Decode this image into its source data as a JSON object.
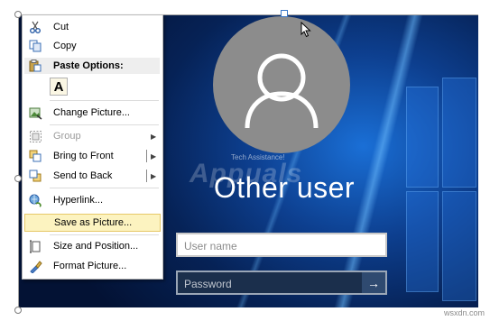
{
  "context_menu": {
    "items": [
      {
        "label": "Cut",
        "icon": "scissors-icon",
        "state": "enabled"
      },
      {
        "label": "Copy",
        "icon": "copy-icon",
        "state": "enabled"
      },
      {
        "label": "Paste Options:",
        "icon": "paste-icon",
        "state": "header"
      },
      {
        "label": "A",
        "icon": "paste-keep-text-icon",
        "state": "enabled"
      },
      {
        "label": "Change Picture...",
        "icon": "change-picture-icon",
        "state": "enabled"
      },
      {
        "label": "Group",
        "icon": "group-icon",
        "state": "disabled",
        "submenu": true
      },
      {
        "label": "Bring to Front",
        "icon": "bring-to-front-icon",
        "state": "enabled",
        "submenu": true
      },
      {
        "label": "Send to Back",
        "icon": "send-to-back-icon",
        "state": "enabled",
        "submenu": true
      },
      {
        "label": "Hyperlink...",
        "icon": "hyperlink-icon",
        "state": "enabled"
      },
      {
        "label": "Save as Picture...",
        "icon": "",
        "state": "highlighted"
      },
      {
        "label": "Size and Position...",
        "icon": "size-position-icon",
        "state": "enabled"
      },
      {
        "label": "Format Picture...",
        "icon": "format-picture-icon",
        "state": "enabled"
      }
    ]
  },
  "login_screen": {
    "username": "Other user",
    "username_placeholder": "User name",
    "password_placeholder": "Password",
    "submit_glyph": "→",
    "avatar_icon": "user-avatar-icon",
    "watermark_caption": "Tech Assistance!",
    "watermark_logo": "Appuals"
  },
  "colors": {
    "highlight_bg": "#fcf3c0",
    "highlight_border": "#e6c867",
    "background_blue": "#0d3f8f"
  },
  "site_watermark": "wsxdn.com"
}
